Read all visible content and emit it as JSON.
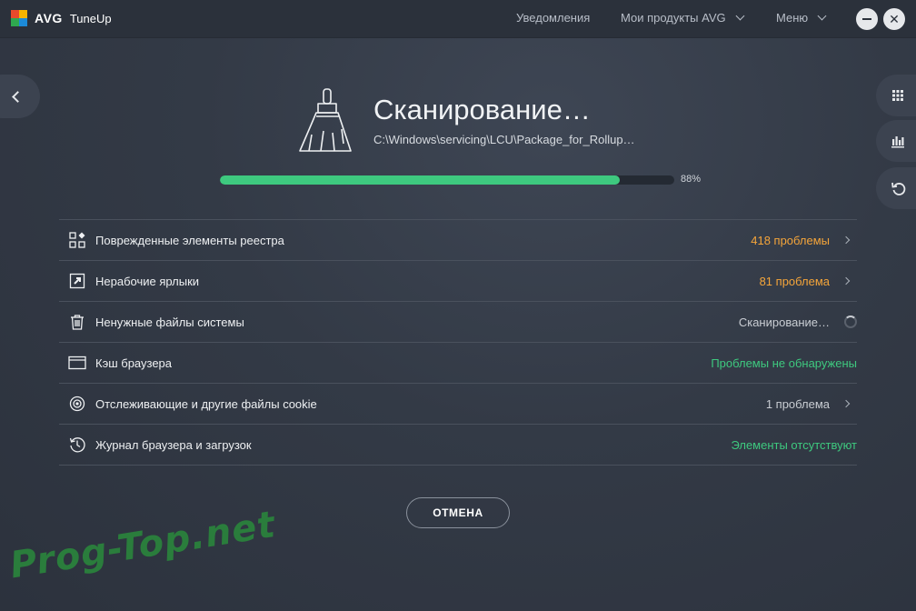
{
  "app": {
    "logo_brand": "AVG",
    "logo_product": "TuneUp"
  },
  "titlebar": {
    "nav": [
      {
        "label": "Уведомления",
        "has_dropdown": false
      },
      {
        "label": "Мои продукты AVG",
        "has_dropdown": true
      },
      {
        "label": "Меню",
        "has_dropdown": true
      }
    ],
    "minimize_icon": "minimize-icon",
    "close_icon": "close-icon"
  },
  "sidebar_right": {
    "buttons": [
      {
        "icon": "grid-icon"
      },
      {
        "icon": "bar-chart-icon"
      },
      {
        "icon": "undo-icon"
      }
    ]
  },
  "scan": {
    "title": "Сканирование…",
    "current_path": "C:\\Windows\\servicing\\LCU\\Package_for_Rollup…",
    "progress_percent": 88,
    "progress_label": "88%"
  },
  "results": [
    {
      "icon": "registry-icon",
      "label": "Поврежденные элементы реестра",
      "status": "418 проблемы",
      "status_type": "issues",
      "chevron": true
    },
    {
      "icon": "shortcut-icon",
      "label": "Нерабочие ярлыки",
      "status": "81 проблема",
      "status_type": "issues",
      "chevron": true
    },
    {
      "icon": "trash-icon",
      "label": "Ненужные файлы системы",
      "status": "Сканирование…",
      "status_type": "scanning",
      "chevron": false
    },
    {
      "icon": "browser-window-icon",
      "label": "Кэш браузера",
      "status": "Проблемы не обнаружены",
      "status_type": "ok",
      "chevron": false
    },
    {
      "icon": "target-icon",
      "label": "Отслеживающие и другие файлы cookie",
      "status": "1 проблема",
      "status_type": "neutral",
      "chevron": true
    },
    {
      "icon": "history-icon",
      "label": "Журнал браузера и загрузок",
      "status": "Элементы отсутствуют",
      "status_type": "ok",
      "chevron": false
    }
  ],
  "actions": {
    "cancel_label": "ОТМЕНА"
  },
  "watermark": "Prog-Top.net",
  "colors": {
    "accent_green": "#3ec97f",
    "issue_orange": "#f5a53a",
    "background": "#333a46"
  }
}
